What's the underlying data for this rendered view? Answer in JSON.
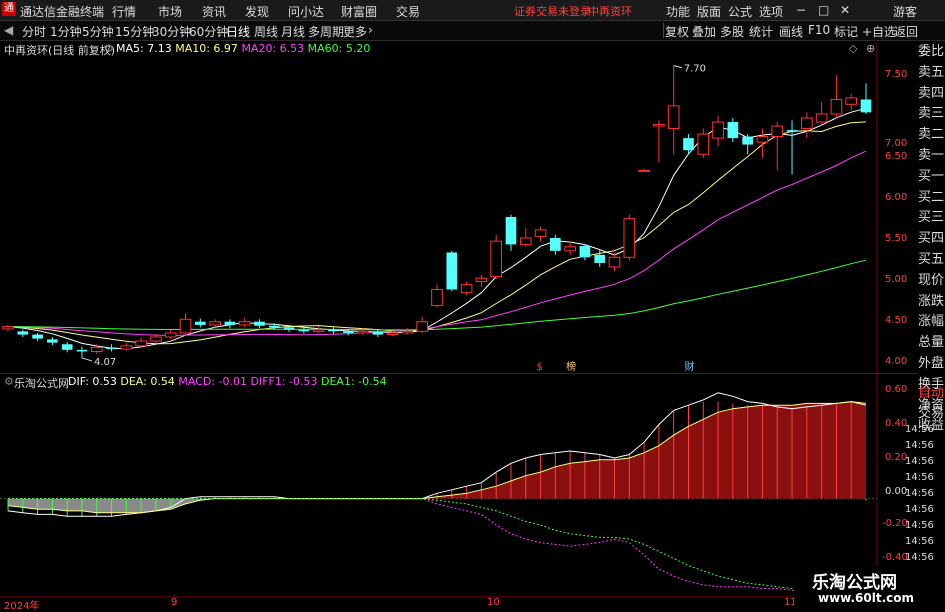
{
  "app": {
    "title": "通达信金融终端",
    "account": "游客",
    "warning": "证券交易未登录",
    "stock_name": "中再资环"
  },
  "menu": [
    "行情",
    "市场",
    "资讯",
    "发现",
    "问小达",
    "财富圈",
    "交易"
  ],
  "menu_right": [
    "功能",
    "版面",
    "公式",
    "选项"
  ],
  "periods": [
    "分时",
    "1分钟",
    "5分钟",
    "15分钟",
    "30分钟",
    "60分钟",
    "日线",
    "周线",
    "月线",
    "多周期",
    "更多"
  ],
  "active_period": "日线",
  "toolbar_right": [
    "复权",
    "叠加",
    "多股",
    "统计",
    "画线",
    "F10",
    "标记",
    "+自选",
    "返回"
  ],
  "main_panel": {
    "title": "中再资环(日线 前复权)",
    "ma": [
      {
        "label": "MA5: 7.13",
        "color": "#ffffff"
      },
      {
        "label": "MA10: 6.97",
        "color": "#ffff80"
      },
      {
        "label": "MA20: 6.53",
        "color": "#ff40ff"
      },
      {
        "label": "MA60: 5.20",
        "color": "#40ff40"
      }
    ],
    "high_label": "7.70",
    "low_label": "4.07",
    "markers": [
      "$",
      "榜",
      "财"
    ]
  },
  "indicator_panel": {
    "title": "乐淘公式网",
    "values": [
      {
        "label": "DIF: 0.53",
        "color": "#ffffff"
      },
      {
        "label": "DEA: 0.54",
        "color": "#ffff80"
      },
      {
        "label": "MACD: -0.01",
        "color": "#ff40ff"
      },
      {
        "label": "DIFF1: -0.53",
        "color": "#ff40ff"
      },
      {
        "label": "DEA1: -0.54",
        "color": "#40ff40"
      }
    ]
  },
  "price_axis": [
    "7.50",
    "7.00",
    "6.50",
    "6.00",
    "5.50",
    "5.00",
    "4.50",
    "4.00"
  ],
  "indicator_axis": [
    "0.60",
    "0.40",
    "0.20",
    "0.00",
    "-0.20",
    "-0.40"
  ],
  "time_axis_labels": [
    "14:56",
    "14:56",
    "14:56",
    "14:56",
    "14:56",
    "14:56",
    "14:56",
    "14:56",
    "14:56"
  ],
  "side_quote": [
    "委比",
    "卖五",
    "卖四",
    "卖三",
    "卖二",
    "卖一",
    "买一",
    "买二",
    "买三",
    "买四",
    "买五",
    "现价",
    "涨跌",
    "涨幅",
    "总量",
    "外盘",
    "换手",
    "净资",
    "收益"
  ],
  "side_bottom": [
    "自动",
    "交易"
  ],
  "dates": [
    "2024年",
    "9",
    "10",
    "11"
  ],
  "watermark": {
    "name": "乐淘公式网",
    "url": "www.60lt.com"
  },
  "chart_data": [
    {
      "type": "candlestick",
      "title": "中再资环(日线 前复权)",
      "ylim": [
        3.92,
        7.82
      ],
      "candles": [
        [
          4.43,
          4.46,
          4.4,
          4.48
        ],
        [
          4.4,
          4.36,
          4.33,
          4.42
        ],
        [
          4.36,
          4.31,
          4.28,
          4.38
        ],
        [
          4.3,
          4.26,
          4.23,
          4.33
        ],
        [
          4.24,
          4.17,
          4.14,
          4.27
        ],
        [
          4.17,
          4.15,
          4.07,
          4.21
        ],
        [
          4.15,
          4.2,
          4.12,
          4.24
        ],
        [
          4.2,
          4.18,
          4.15,
          4.24
        ],
        [
          4.18,
          4.22,
          4.16,
          4.26
        ],
        [
          4.22,
          4.28,
          4.2,
          4.32
        ],
        [
          4.28,
          4.33,
          4.25,
          4.37
        ],
        [
          4.33,
          4.38,
          4.3,
          4.42
        ],
        [
          4.38,
          4.55,
          4.35,
          4.62
        ],
        [
          4.52,
          4.48,
          4.45,
          4.56
        ],
        [
          4.48,
          4.52,
          4.45,
          4.55
        ],
        [
          4.52,
          4.48,
          4.44,
          4.55
        ],
        [
          4.48,
          4.52,
          4.45,
          4.57
        ],
        [
          4.52,
          4.47,
          4.44,
          4.55
        ],
        [
          4.47,
          4.45,
          4.42,
          4.5
        ],
        [
          4.45,
          4.42,
          4.39,
          4.48
        ],
        [
          4.42,
          4.4,
          4.37,
          4.45
        ],
        [
          4.4,
          4.42,
          4.38,
          4.46
        ],
        [
          4.42,
          4.4,
          4.37,
          4.45
        ],
        [
          4.4,
          4.38,
          4.35,
          4.43
        ],
        [
          4.38,
          4.4,
          4.35,
          4.44
        ],
        [
          4.4,
          4.36,
          4.33,
          4.42
        ],
        [
          4.36,
          4.38,
          4.34,
          4.41
        ],
        [
          4.38,
          4.4,
          4.36,
          4.44
        ],
        [
          4.4,
          4.52,
          4.38,
          4.58
        ],
        [
          4.72,
          4.92,
          4.7,
          4.98
        ],
        [
          5.38,
          4.92,
          4.9,
          5.4
        ],
        [
          4.88,
          4.98,
          4.85,
          5.02
        ],
        [
          5.02,
          5.06,
          4.95,
          5.1
        ],
        [
          5.08,
          5.52,
          5.05,
          5.6
        ],
        [
          5.82,
          5.48,
          5.4,
          5.85
        ],
        [
          5.48,
          5.56,
          5.45,
          5.68
        ],
        [
          5.58,
          5.66,
          5.52,
          5.7
        ],
        [
          5.56,
          5.4,
          5.35,
          5.6
        ],
        [
          5.4,
          5.45,
          5.35,
          5.52
        ],
        [
          5.46,
          5.32,
          5.28,
          5.48
        ],
        [
          5.35,
          5.25,
          5.2,
          5.42
        ],
        [
          5.2,
          5.32,
          5.15,
          5.38
        ],
        [
          5.32,
          5.8,
          5.28,
          5.85
        ],
        [
          6.4,
          6.4,
          6.38,
          6.42
        ],
        [
          6.95,
          6.97,
          6.5,
          7.02
        ],
        [
          6.92,
          7.2,
          6.6,
          7.7
        ],
        [
          6.8,
          6.65,
          6.6,
          6.85
        ],
        [
          6.6,
          6.85,
          6.55,
          6.92
        ],
        [
          6.8,
          7.0,
          6.7,
          7.08
        ],
        [
          7.0,
          6.8,
          6.75,
          7.05
        ],
        [
          6.82,
          6.72,
          6.6,
          6.85
        ],
        [
          6.75,
          6.82,
          6.55,
          6.92
        ],
        [
          6.82,
          6.95,
          6.4,
          7.0
        ],
        [
          6.9,
          6.88,
          6.35,
          7.02
        ],
        [
          6.92,
          7.05,
          6.8,
          7.12
        ],
        [
          7.0,
          7.1,
          6.95,
          7.25
        ],
        [
          7.1,
          7.28,
          7.05,
          7.58
        ],
        [
          7.22,
          7.3,
          7.15,
          7.35
        ],
        [
          7.28,
          7.12,
          7.1,
          7.48
        ]
      ],
      "ma_values": {
        "MA5": 7.13,
        "MA10": 6.97,
        "MA20": 6.53,
        "MA60": 5.2
      }
    },
    {
      "type": "line",
      "title": "乐淘公式网",
      "ylim": [
        -0.53,
        0.65
      ],
      "series": [
        {
          "name": "DIF",
          "values": [
            -0.07,
            -0.08,
            -0.09,
            -0.09,
            -0.1,
            -0.1,
            -0.1,
            -0.1,
            -0.09,
            -0.08,
            -0.07,
            -0.05,
            0.0,
            0.01,
            0.01,
            0.01,
            0.01,
            0.01,
            0.01,
            0.0,
            0.0,
            0.0,
            0.0,
            0.0,
            0.0,
            0.0,
            0.0,
            0.0,
            0.0,
            0.03,
            0.05,
            0.07,
            0.09,
            0.15,
            0.2,
            0.23,
            0.25,
            0.26,
            0.27,
            0.26,
            0.25,
            0.23,
            0.25,
            0.32,
            0.42,
            0.5,
            0.53,
            0.56,
            0.6,
            0.58,
            0.55,
            0.54,
            0.52,
            0.51,
            0.52,
            0.53,
            0.54,
            0.55,
            0.53
          ]
        },
        {
          "name": "DEA",
          "values": [
            -0.04,
            -0.05,
            -0.06,
            -0.06,
            -0.07,
            -0.07,
            -0.08,
            -0.08,
            -0.08,
            -0.08,
            -0.07,
            -0.06,
            -0.03,
            -0.01,
            0.0,
            0.0,
            0.0,
            0.0,
            0.0,
            0.0,
            0.0,
            0.0,
            0.0,
            0.0,
            0.0,
            0.0,
            0.0,
            0.0,
            0.0,
            0.01,
            0.02,
            0.03,
            0.05,
            0.07,
            0.1,
            0.13,
            0.15,
            0.18,
            0.2,
            0.21,
            0.22,
            0.22,
            0.23,
            0.26,
            0.3,
            0.36,
            0.41,
            0.45,
            0.49,
            0.51,
            0.52,
            0.53,
            0.53,
            0.53,
            0.54,
            0.54,
            0.54,
            0.55,
            0.54
          ]
        },
        {
          "name": "DIFF1",
          "values": [
            0.0,
            0.0,
            0.0,
            0.0,
            0.0,
            0.0,
            0.0,
            0.0,
            0.0,
            0.0,
            0.0,
            0.0,
            0.0,
            0.0,
            0.0,
            0.0,
            0.0,
            0.0,
            0.0,
            0.0,
            0.0,
            0.0,
            0.0,
            0.0,
            0.0,
            0.0,
            0.0,
            0.0,
            0.0,
            -0.03,
            -0.05,
            -0.07,
            -0.09,
            -0.15,
            -0.2,
            -0.23,
            -0.25,
            -0.26,
            -0.27,
            -0.26,
            -0.25,
            -0.23,
            -0.25,
            -0.32,
            -0.4,
            -0.44,
            -0.47,
            -0.49,
            -0.5,
            -0.5,
            -0.5,
            -0.51,
            -0.51,
            -0.52,
            -0.52,
            -0.53,
            -0.53,
            -0.53,
            -0.53
          ]
        },
        {
          "name": "DEA1",
          "values": [
            0.0,
            0.0,
            0.0,
            0.0,
            0.0,
            0.0,
            0.0,
            0.0,
            0.0,
            0.0,
            0.0,
            0.0,
            0.0,
            0.0,
            0.0,
            0.0,
            0.0,
            0.0,
            0.0,
            0.0,
            0.0,
            0.0,
            0.0,
            0.0,
            0.0,
            0.0,
            0.0,
            0.0,
            0.0,
            -0.01,
            -0.02,
            -0.03,
            -0.05,
            -0.07,
            -0.1,
            -0.13,
            -0.15,
            -0.18,
            -0.2,
            -0.21,
            -0.22,
            -0.22,
            -0.23,
            -0.26,
            -0.3,
            -0.34,
            -0.38,
            -0.41,
            -0.44,
            -0.46,
            -0.48,
            -0.49,
            -0.5,
            -0.51,
            -0.52,
            -0.52,
            -0.53,
            -0.53,
            -0.54
          ]
        },
        {
          "name": "MACD",
          "values": [
            -0.07,
            -0.08,
            -0.09,
            -0.09,
            -0.1,
            -0.1,
            -0.1,
            -0.1,
            -0.09,
            -0.08,
            -0.07,
            -0.05,
            0.0,
            0.01,
            0.01,
            0.01,
            0.01,
            0.01,
            0.01,
            0.0,
            0.0,
            0.0,
            0.0,
            0.0,
            0.0,
            0.0,
            0.0,
            0.0,
            0.0,
            0.03,
            0.05,
            0.07,
            0.09,
            0.15,
            0.2,
            0.23,
            0.25,
            0.26,
            0.27,
            0.26,
            0.25,
            0.23,
            0.25,
            0.32,
            0.42,
            0.5,
            0.53,
            0.55,
            0.55,
            0.54,
            0.53,
            0.53,
            0.52,
            0.51,
            0.52,
            0.53,
            0.54,
            0.55,
            -0.01
          ]
        }
      ]
    }
  ]
}
